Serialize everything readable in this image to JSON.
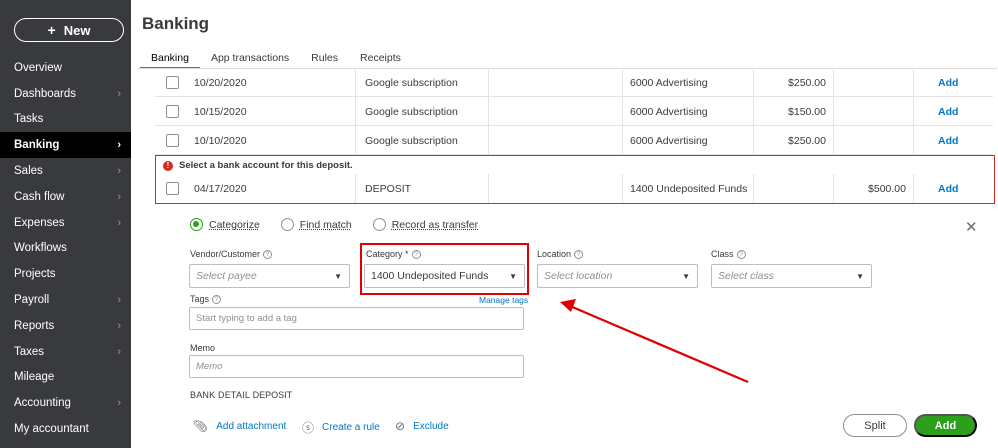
{
  "sidebar": {
    "new_label": "New",
    "items": [
      {
        "label": "Overview",
        "chevron": false,
        "active": false
      },
      {
        "label": "Dashboards",
        "chevron": true,
        "active": false
      },
      {
        "label": "Tasks",
        "chevron": false,
        "active": false
      },
      {
        "label": "Banking",
        "chevron": true,
        "active": true
      },
      {
        "label": "Sales",
        "chevron": true,
        "active": false
      },
      {
        "label": "Cash flow",
        "chevron": true,
        "active": false
      },
      {
        "label": "Expenses",
        "chevron": true,
        "active": false
      },
      {
        "label": "Workflows",
        "chevron": false,
        "active": false
      },
      {
        "label": "Projects",
        "chevron": false,
        "active": false
      },
      {
        "label": "Payroll",
        "chevron": true,
        "active": false
      },
      {
        "label": "Reports",
        "chevron": true,
        "active": false
      },
      {
        "label": "Taxes",
        "chevron": true,
        "active": false
      },
      {
        "label": "Mileage",
        "chevron": false,
        "active": false
      },
      {
        "label": "Accounting",
        "chevron": true,
        "active": false
      },
      {
        "label": "My accountant",
        "chevron": false,
        "active": false
      }
    ]
  },
  "header": {
    "title": "Banking",
    "tabs": [
      "Banking",
      "App transactions",
      "Rules",
      "Receipts"
    ]
  },
  "transactions": [
    {
      "date": "10/20/2020",
      "description": "Google subscription",
      "category": "6000 Advertising",
      "spent": "$250.00",
      "received": "",
      "action": "Add"
    },
    {
      "date": "10/15/2020",
      "description": "Google subscription",
      "category": "6000 Advertising",
      "spent": "$150.00",
      "received": "",
      "action": "Add"
    },
    {
      "date": "10/10/2020",
      "description": "Google subscription",
      "category": "6000 Advertising",
      "spent": "$250.00",
      "received": "",
      "action": "Add"
    },
    {
      "date": "04/17/2020",
      "description": "DEPOSIT",
      "category": "1400 Undeposited Funds",
      "spent": "",
      "received": "$500.00",
      "action": "Add"
    }
  ],
  "error": {
    "message": "Select a bank account for this deposit."
  },
  "detail": {
    "radios": [
      "Categorize",
      "Find match",
      "Record as transfer"
    ],
    "vendor_label": "Vendor/Customer",
    "vendor_placeholder": "Select payee",
    "category_label": "Category *",
    "category_value": "1400 Undeposited Funds",
    "location_label": "Location",
    "location_placeholder": "Select location",
    "class_label": "Class",
    "class_placeholder": "Select class",
    "tags_label": "Tags",
    "manage_tags": "Manage tags",
    "tags_placeholder": "Start typing to add a tag",
    "memo_label": "Memo",
    "memo_placeholder": "Memo",
    "bank_detail_label": "BANK DETAIL",
    "bank_detail_value": "DEPOSIT",
    "add_attachment": "Add attachment",
    "create_rule": "Create a rule",
    "exclude": "Exclude",
    "split": "Split",
    "add": "Add"
  },
  "colors": {
    "sidebar_bg": "#393a3d",
    "accent_green": "#2ca01c",
    "link_blue": "#0077c5",
    "error_red": "#d52b1e",
    "annotation_red": "#e00000"
  }
}
